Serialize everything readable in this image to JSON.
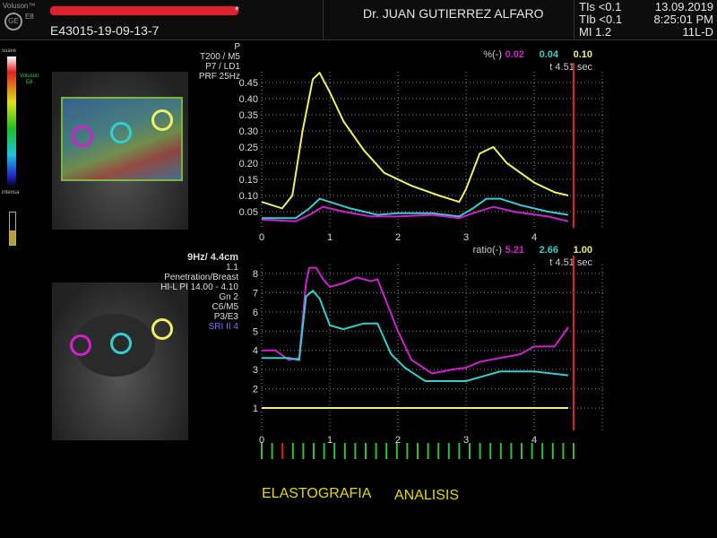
{
  "header": {
    "brand": "Voluson™",
    "model": "E8",
    "patient_id": "E43015-19-09-13-7",
    "asterisk": "*",
    "doctor": "Dr. JUAN GUTIERREZ ALFARO",
    "tis": "TIs <0.1",
    "tib": "TIb <0.1",
    "mi": "MI  1.2",
    "date": "13.09.2019",
    "time": "8:25:01 PM",
    "probe": "11L-D"
  },
  "colorbar": {
    "top": "suave",
    "bottom": "intensa",
    "brand": "Voluson",
    "model": "E8"
  },
  "params_top": [
    "P",
    "T200 / M5",
    "P7 / LD1",
    "PRF 25Hz"
  ],
  "params_bottom": {
    "head": "9Hz/ 4.4cm",
    "lines": [
      "1.1",
      "Penetration/Breast",
      "HI-L PI 14.00 - 4.10",
      "Gn   2",
      "C6/M5",
      "P3/E3"
    ],
    "sri": "SRI II 4"
  },
  "colors": {
    "magenta": "#d020d0",
    "cyan": "#30d0d0",
    "yellow": "#f0f060",
    "cursor": "#e02020"
  },
  "chart_data": [
    {
      "type": "line",
      "title": "%(-)",
      "legend_values": [
        "0.02",
        "0.04",
        "0.10"
      ],
      "time_label": "t 4.51 sec",
      "cursor_t": 4.51,
      "xlim": [
        0,
        4.8
      ],
      "ylim": [
        0,
        0.5
      ],
      "xticks": [
        "0",
        "1",
        "2",
        "3",
        "4"
      ],
      "yticks": [
        "0.05",
        "0.10",
        "0.15",
        "0.20",
        "0.25",
        "0.30",
        "0.35",
        "0.40",
        "0.45"
      ],
      "series": [
        {
          "name": "yellow",
          "color": "#f0f060",
          "x": [
            0,
            0.3,
            0.45,
            0.6,
            0.75,
            0.85,
            1.0,
            1.2,
            1.5,
            1.8,
            2.2,
            2.6,
            2.9,
            3.0,
            3.2,
            3.4,
            3.6,
            4.0,
            4.3,
            4.5
          ],
          "y": [
            0.08,
            0.06,
            0.1,
            0.3,
            0.46,
            0.48,
            0.42,
            0.33,
            0.24,
            0.17,
            0.13,
            0.1,
            0.08,
            0.12,
            0.23,
            0.25,
            0.2,
            0.14,
            0.11,
            0.1
          ]
        },
        {
          "name": "cyan",
          "color": "#30d0d0",
          "x": [
            0,
            0.5,
            0.7,
            0.85,
            1.0,
            1.3,
            1.7,
            2.0,
            2.5,
            2.9,
            3.1,
            3.3,
            3.5,
            3.8,
            4.2,
            4.5
          ],
          "y": [
            0.03,
            0.03,
            0.06,
            0.09,
            0.08,
            0.06,
            0.04,
            0.045,
            0.045,
            0.035,
            0.06,
            0.09,
            0.09,
            0.07,
            0.05,
            0.04
          ]
        },
        {
          "name": "magenta",
          "color": "#d020d0",
          "x": [
            0,
            0.5,
            0.7,
            0.9,
            1.2,
            1.6,
            2.0,
            2.5,
            2.9,
            3.1,
            3.4,
            3.7,
            4.2,
            4.5
          ],
          "y": [
            0.025,
            0.02,
            0.04,
            0.065,
            0.05,
            0.035,
            0.035,
            0.04,
            0.03,
            0.045,
            0.065,
            0.05,
            0.035,
            0.02
          ]
        }
      ]
    },
    {
      "type": "line",
      "title": "ratio(-)",
      "legend_values": [
        "5.21",
        "2.66",
        "1.00"
      ],
      "time_label": "t 4.51 sec",
      "cursor_t": 4.51,
      "xlim": [
        0,
        4.8
      ],
      "ylim": [
        0.5,
        8.5
      ],
      "xticks": [
        "0",
        "1",
        "2",
        "3",
        "4"
      ],
      "yticks": [
        "1",
        "2",
        "3",
        "4",
        "5",
        "6",
        "7",
        "8"
      ],
      "series": [
        {
          "name": "magenta",
          "color": "#d020d0",
          "x": [
            0,
            0.2,
            0.4,
            0.55,
            0.65,
            0.7,
            0.8,
            0.9,
            1.0,
            1.2,
            1.4,
            1.6,
            1.7,
            2.0,
            2.2,
            2.5,
            2.8,
            3.0,
            3.2,
            3.5,
            3.8,
            4.0,
            4.3,
            4.5
          ],
          "y": [
            4.0,
            4.0,
            3.5,
            3.6,
            7.5,
            8.3,
            8.3,
            7.7,
            7.3,
            7.5,
            7.8,
            7.6,
            7.7,
            5.0,
            3.5,
            2.8,
            3.0,
            3.1,
            3.4,
            3.6,
            3.8,
            4.2,
            4.2,
            5.2
          ]
        },
        {
          "name": "cyan",
          "color": "#30d0d0",
          "x": [
            0,
            0.4,
            0.55,
            0.65,
            0.75,
            0.85,
            1.0,
            1.2,
            1.5,
            1.7,
            1.9,
            2.1,
            2.4,
            3.0,
            3.3,
            3.5,
            4.0,
            4.5
          ],
          "y": [
            3.6,
            3.6,
            3.5,
            6.8,
            7.1,
            6.7,
            5.3,
            5.1,
            5.4,
            5.4,
            3.8,
            3.1,
            2.4,
            2.4,
            2.7,
            2.9,
            2.9,
            2.7
          ]
        },
        {
          "name": "yellow",
          "color": "#f0f060",
          "x": [
            0,
            4.5
          ],
          "y": [
            1,
            1
          ]
        }
      ]
    }
  ],
  "footer": {
    "left": "ELASTOGRAFIA",
    "right": "ANALISIS"
  }
}
